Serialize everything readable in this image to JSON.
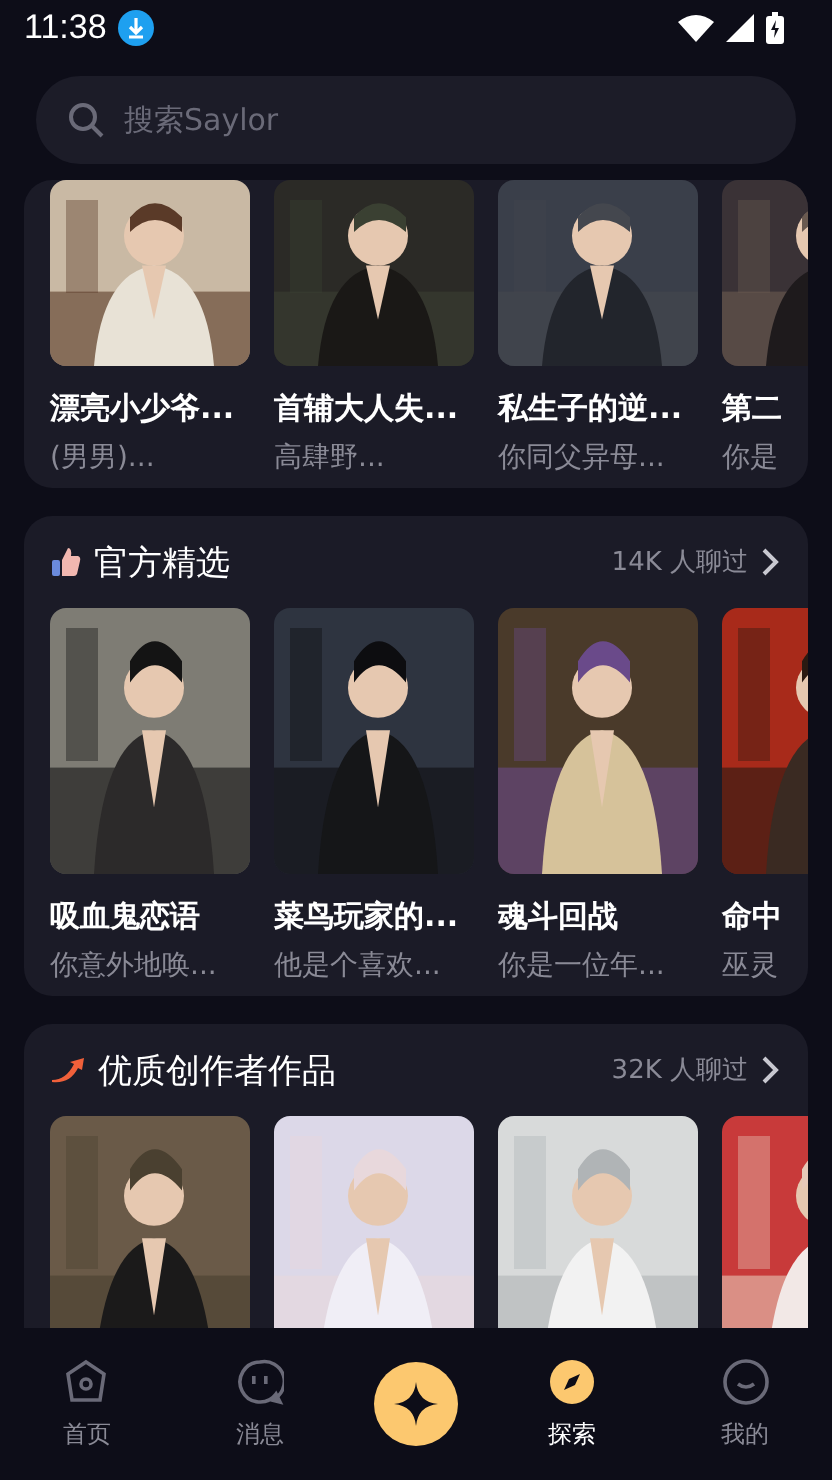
{
  "status_bar": {
    "time": "11:38"
  },
  "search": {
    "placeholder": "搜索Saylor"
  },
  "sections": [
    {
      "kind": "cropped",
      "items": [
        {
          "title": "漂亮小少爷...",
          "subtitle": "(男男)..."
        },
        {
          "title": "首辅大人失...",
          "subtitle": "高肆野..."
        },
        {
          "title": "私生子的逆...",
          "subtitle": "你同父异母..."
        },
        {
          "title": "第二",
          "subtitle": "你是"
        }
      ]
    },
    {
      "kind": "thumb",
      "title": "官方精选",
      "count": "14K 人聊过",
      "items": [
        {
          "title": "吸血鬼恋语",
          "subtitle": "你意外地唤..."
        },
        {
          "title": "菜鸟玩家的...",
          "subtitle": "他是个喜欢..."
        },
        {
          "title": "魂斗回战",
          "subtitle": "你是一位年..."
        },
        {
          "title": "命中",
          "subtitle": "巫灵"
        }
      ]
    },
    {
      "kind": "trend",
      "title": "优质创作者作品",
      "count": "32K 人聊过"
    }
  ],
  "nav": [
    {
      "kind": "home",
      "label": "首页",
      "selected": false
    },
    {
      "kind": "chat",
      "label": "消息",
      "selected": false
    },
    {
      "kind": "create"
    },
    {
      "kind": "explore",
      "label": "探索",
      "selected": true
    },
    {
      "kind": "me",
      "label": "我的",
      "selected": false
    }
  ]
}
